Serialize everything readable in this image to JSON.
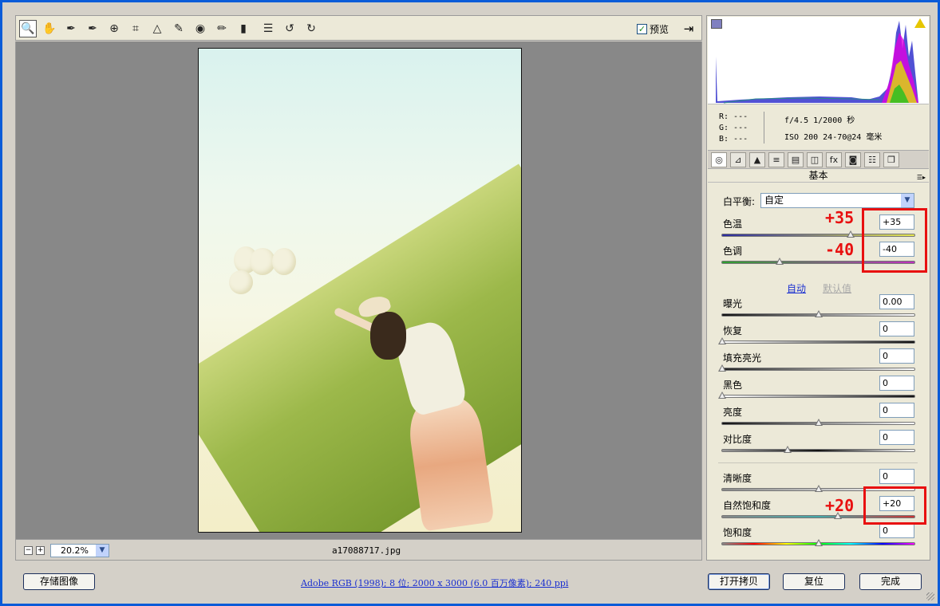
{
  "toolbar": {
    "tools": [
      {
        "name": "zoom-tool",
        "glyph": "🔍"
      },
      {
        "name": "hand-tool",
        "glyph": "✋"
      },
      {
        "name": "white-balance-tool",
        "glyph": "✒"
      },
      {
        "name": "color-sampler-tool",
        "glyph": "✒"
      },
      {
        "name": "target-adjust-tool",
        "glyph": "⊕"
      },
      {
        "name": "crop-tool",
        "glyph": "⌗"
      },
      {
        "name": "straighten-tool",
        "glyph": "△"
      },
      {
        "name": "spot-removal-tool",
        "glyph": "✎"
      },
      {
        "name": "red-eye-tool",
        "glyph": "◉"
      },
      {
        "name": "adjustment-brush-tool",
        "glyph": "✏"
      },
      {
        "name": "graduated-filter-tool",
        "glyph": "▮"
      },
      {
        "name": "preferences-tool",
        "glyph": "☰"
      },
      {
        "name": "rotate-ccw-tool",
        "glyph": "↺"
      },
      {
        "name": "rotate-cw-tool",
        "glyph": "↻"
      }
    ],
    "preview_label": "预览",
    "preview_checked": "✓",
    "fullscreen_glyph": "⇥"
  },
  "statusbar": {
    "zoom_minus": "−",
    "zoom_plus": "+",
    "zoom_value": "20.2%",
    "filename": "a17088717.jpg"
  },
  "readout": {
    "r": "R:  ---",
    "g": "G:  ---",
    "b": "B:  ---",
    "exposure": "f/4.5   1/2000 秒",
    "iso_lens": "ISO 200   24-70@24 毫米"
  },
  "panel": {
    "tabs": [
      "◎",
      "⊿",
      "▲",
      "≡",
      "▤",
      "◫",
      "fx",
      "◙",
      "☷",
      "❐"
    ],
    "section_title": "基本",
    "white_balance_label": "白平衡:",
    "white_balance_value": "自定",
    "auto_link": "自动",
    "default_link": "默认值",
    "sliders": [
      {
        "key": "temperature",
        "label": "色温",
        "value": "+35",
        "pos": 0.67,
        "track": "linear-gradient(90deg,#2a2aa0,#e8e850)"
      },
      {
        "key": "tint",
        "label": "色调",
        "value": "-40",
        "pos": 0.3,
        "track": "linear-gradient(90deg,#2ea02e,#c030c0)"
      },
      {
        "key": "exposure",
        "label": "曝光",
        "value": "0.00",
        "pos": 0.5,
        "track": "linear-gradient(90deg,#111,#fff)"
      },
      {
        "key": "recovery",
        "label": "恢复",
        "value": "0",
        "pos": 0.0,
        "track": "linear-gradient(90deg,#fff,#111)"
      },
      {
        "key": "fill-light",
        "label": "填充亮光",
        "value": "0",
        "pos": 0.0,
        "track": "linear-gradient(90deg,#222,#fff)"
      },
      {
        "key": "blacks",
        "label": "黑色",
        "value": "0",
        "pos": 0.0,
        "track": "linear-gradient(90deg,#fff,#111)"
      },
      {
        "key": "brightness",
        "label": "亮度",
        "value": "0",
        "pos": 0.5,
        "track": "linear-gradient(90deg,#111,#fff)"
      },
      {
        "key": "contrast",
        "label": "对比度",
        "value": "0",
        "pos": 0.34,
        "track": "linear-gradient(90deg,#999,#111 50%,#fff)"
      },
      {
        "key": "clarity",
        "label": "清晰度",
        "value": "0",
        "pos": 0.5,
        "track": "linear-gradient(90deg,#888,#fff)"
      },
      {
        "key": "vibrance",
        "label": "自然饱和度",
        "value": "+20",
        "pos": 0.6,
        "track": "linear-gradient(90deg,#888,#4aa,#c33)"
      },
      {
        "key": "saturation",
        "label": "饱和度",
        "value": "0",
        "pos": 0.5,
        "track": "linear-gradient(90deg,#888,#f00,#ff0,#0f0,#0ff,#00f,#f0f)"
      }
    ]
  },
  "annotations": {
    "temp_value": "+35",
    "tint_value": "-40",
    "vibrance_value": "+20"
  },
  "bottom": {
    "save_label": "存储图像",
    "info_link": "Adobe RGB (1998); 8 位;  2000 x 3000 (6.0 百万像素); 240 ppi",
    "open_label": "打开拷贝",
    "reset_label": "复位",
    "done_label": "完成"
  }
}
